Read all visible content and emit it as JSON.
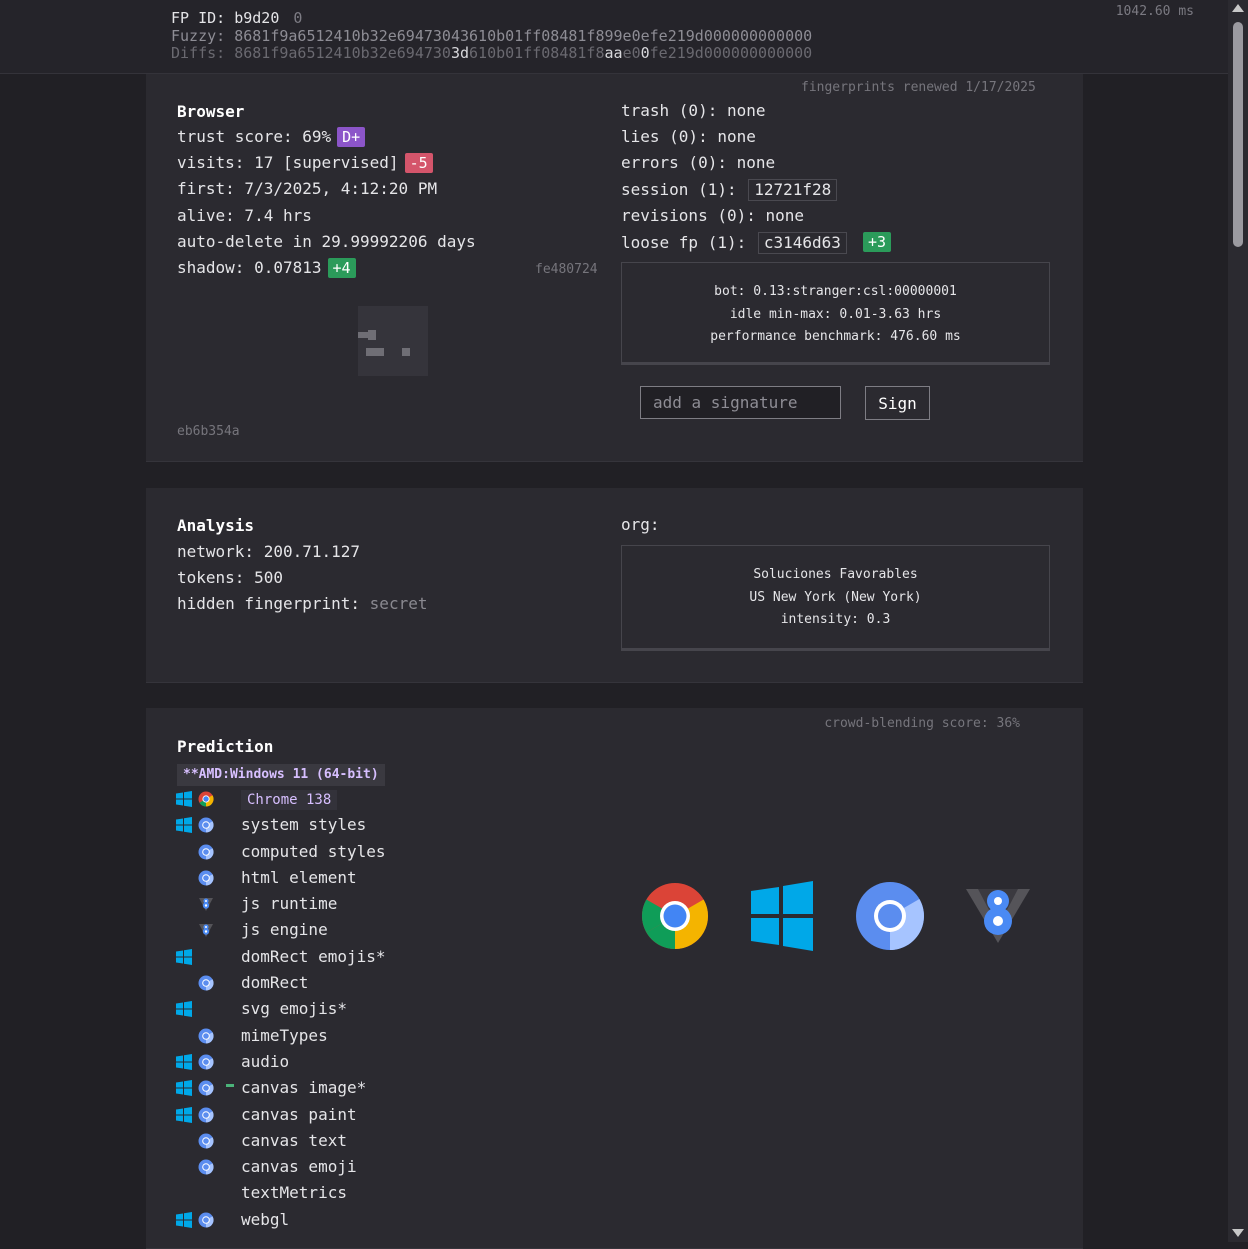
{
  "header": {
    "fp_id": "FP ID: b9d20",
    "fp_zero": "0",
    "fuzzy": "Fuzzy: 8681f9a6512410b32e69473043610b01ff08481f899e0efe219d000000000000",
    "diffs_prefix": "Diffs: 8681f9a6512410b32e694730",
    "diffs_hl1": "3d",
    "diffs_mid": "610b01ff08481f8",
    "diffs_hl2": "aa",
    "diffs_mid2": "e0",
    "diffs_hl3": "0",
    "diffs_end": "fe219d000000000000",
    "time": "1042.60 ms"
  },
  "browser": {
    "renewed": "fingerprints renewed 1/17/2025",
    "title": "Browser",
    "trust_score": "trust score: 69%",
    "trust_grade": "D+",
    "visits": "visits: 17 [supervised]",
    "visits_delta": "-5",
    "first": "first: 7/3/2025, 4:12:20 PM",
    "alive": "alive: 7.4 hrs",
    "auto_delete": "auto-delete in 29.99992206 days",
    "shadow": "shadow: 0.07813",
    "shadow_delta": "+4",
    "hash_right": "fe480724",
    "hash_bottom": "eb6b354a",
    "trash": "trash (0): none",
    "lies": "lies (0): none",
    "errors": "errors (0): none",
    "session_label": "session (1):",
    "session_hash": "12721f28",
    "revisions": "revisions (0): none",
    "loose_label": "loose fp (1):",
    "loose_hash": "c3146d63",
    "loose_delta": "+3",
    "bot": "bot: 0.13:stranger:csl:00000001",
    "idle": "idle min-max: 0.01-3.63 hrs",
    "benchmark": "performance benchmark: 476.60 ms",
    "signature_placeholder": "add a signature",
    "sign_label": "Sign"
  },
  "analysis": {
    "title": "Analysis",
    "network": "network: 200.71.127",
    "tokens": "tokens: 500",
    "hidden_label": "hidden fingerprint:",
    "hidden_value": "secret",
    "org_label": "org:",
    "org_name": "Soluciones Favorables",
    "org_location": "US New York (New York)",
    "org_intensity": "intensity: 0.3"
  },
  "prediction": {
    "title": "Prediction",
    "crowd": "crowd-blending score: 36%",
    "platform": "**AMD:Windows 11 (64-bit)",
    "items": [
      {
        "label": "Chrome 138",
        "win": true,
        "icon": "chrome",
        "tag": true
      },
      {
        "label": "system styles",
        "win": true,
        "icon": "chromium"
      },
      {
        "label": "computed styles",
        "win": false,
        "icon": "chromium"
      },
      {
        "label": "html element",
        "win": false,
        "icon": "chromium"
      },
      {
        "label": "js runtime",
        "win": false,
        "icon": "v8"
      },
      {
        "label": "js engine",
        "win": false,
        "icon": "v8"
      },
      {
        "label": "domRect emojis*",
        "win": true,
        "icon": "none"
      },
      {
        "label": "domRect",
        "win": false,
        "icon": "chromium"
      },
      {
        "label": "svg emojis*",
        "win": true,
        "icon": "none"
      },
      {
        "label": "mimeTypes",
        "win": false,
        "icon": "chromium"
      },
      {
        "label": "audio",
        "win": true,
        "icon": "chromium"
      },
      {
        "label": "canvas image*",
        "win": true,
        "icon": "chromium",
        "tick": true
      },
      {
        "label": "canvas paint",
        "win": true,
        "icon": "chromium"
      },
      {
        "label": "canvas text",
        "win": false,
        "icon": "chromium"
      },
      {
        "label": "canvas emoji",
        "win": false,
        "icon": "chromium"
      },
      {
        "label": "textMetrics",
        "win": false,
        "icon": "none"
      },
      {
        "label": "webgl",
        "win": true,
        "icon": "chromium"
      }
    ],
    "big_icons": [
      "chrome-icon",
      "windows-icon",
      "chromium-icon",
      "v8-icon"
    ]
  },
  "colors": {
    "background": "#212025",
    "card": "#2b2a30",
    "purple": "#8c55c9",
    "red": "#d4556b",
    "green": "#2b9b5a",
    "windows_blue": "#00a8e8",
    "chromium_blue": "#5b8def"
  }
}
